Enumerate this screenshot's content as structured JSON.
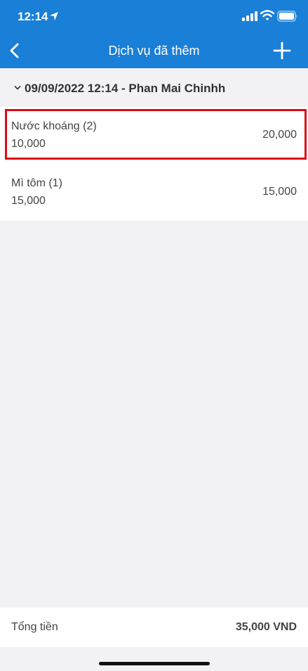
{
  "status_bar": {
    "time": "12:14"
  },
  "nav": {
    "title": "Dịch vụ đã thêm"
  },
  "group": {
    "title": "09/09/2022 12:14 - Phan Mai Chinhh"
  },
  "items": [
    {
      "name": "Nước khoáng (2)",
      "unit_price": "10,000",
      "total": "20,000",
      "selected": true
    },
    {
      "name": "Mì tôm (1)",
      "unit_price": "15,000",
      "total": "15,000",
      "selected": false
    }
  ],
  "footer": {
    "label": "Tổng tiền",
    "value": "35,000 VND"
  },
  "colors": {
    "header": "#1a7fd6",
    "highlight": "#dd0a12",
    "background": "#f2f2f4"
  }
}
